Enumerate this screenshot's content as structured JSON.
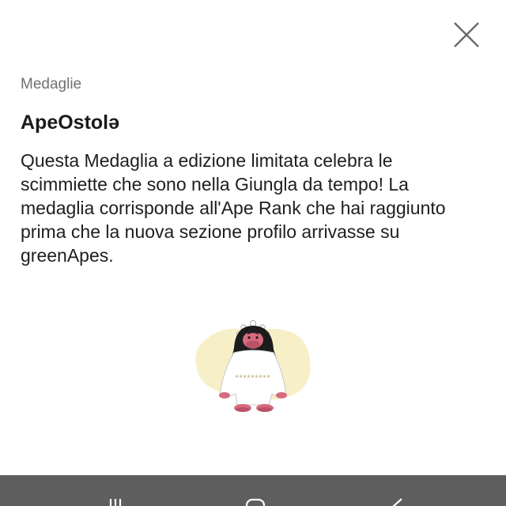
{
  "dialog": {
    "category": "Medaglie",
    "title": "ApeOstolə",
    "description": "Questa Medaglia a edizione limitata celebra le scimmiette che sono nella Giungla da tempo! La medaglia corrisponde all'Ape Rank che hai raggiunto prima che la nuova sezione profilo arrivasse su greenApes.",
    "close_icon": "close-icon",
    "medal_icon": "ape-medal-icon"
  },
  "navbar": {
    "buttons": [
      "recents-icon",
      "home-icon",
      "back-icon"
    ]
  },
  "colors": {
    "background": "#ffffff",
    "navbar": "#5e5e5e",
    "medal_backdrop": "#f6efc8",
    "ape_fur": "#1c1c1c",
    "ape_face": "#d76b7e",
    "robe": "#ffffff"
  }
}
